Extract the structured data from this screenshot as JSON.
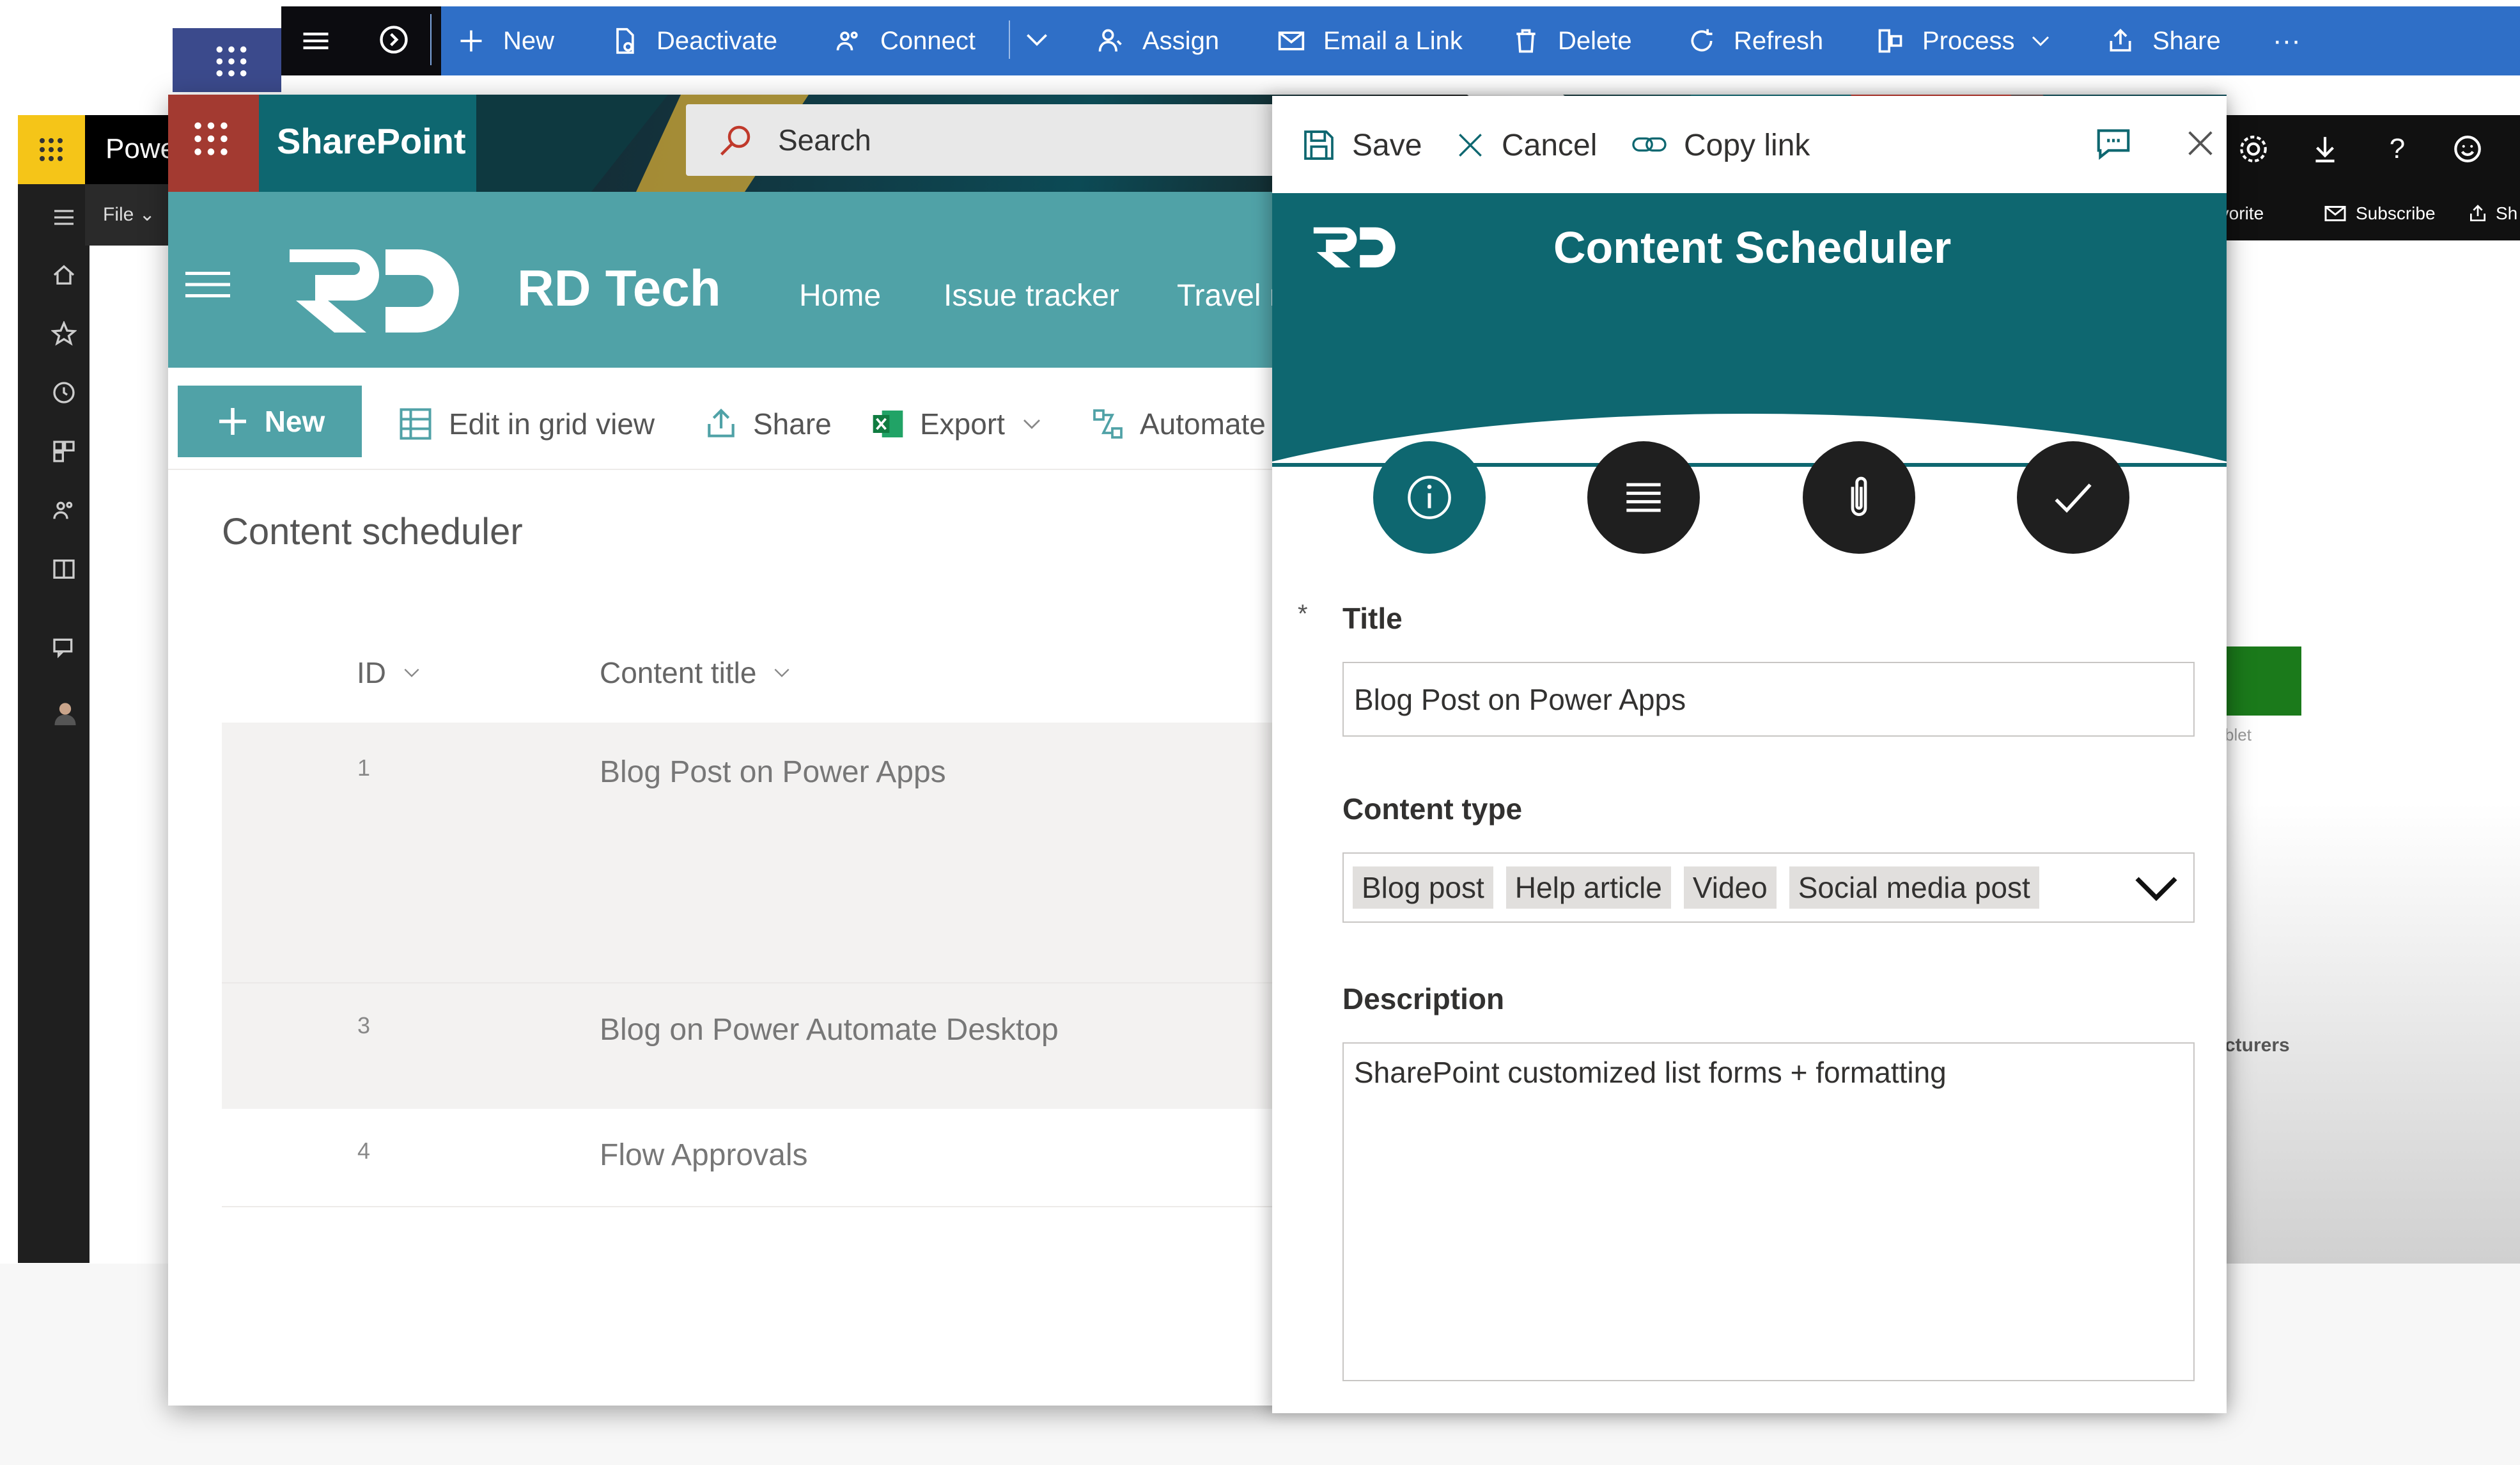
{
  "command_bar": {
    "items": [
      {
        "label": "New",
        "icon": "plus-icon"
      },
      {
        "label": "Deactivate",
        "icon": "document-icon"
      },
      {
        "label": "Connect",
        "icon": "people-icon"
      },
      {
        "label": "Assign",
        "icon": "person-icon"
      },
      {
        "label": "Email a Link",
        "icon": "email-icon"
      },
      {
        "label": "Delete",
        "icon": "trash-icon"
      },
      {
        "label": "Refresh",
        "icon": "refresh-icon"
      },
      {
        "label": "Process",
        "icon": "process-icon"
      },
      {
        "label": "Share",
        "icon": "share-icon"
      }
    ],
    "overflow": "···"
  },
  "background_app": {
    "title_fragment": "Powe",
    "file_menu": "File",
    "favorite": "Favorite",
    "subscribe": "Subscribe",
    "share_fragment": "Sh",
    "text_fragment_1": "blet",
    "text_fragment_2": "cturers"
  },
  "sharepoint": {
    "brand": "SharePoint",
    "search_placeholder": "Search",
    "site_title": "RD Tech",
    "nav": [
      "Home",
      "Issue tracker",
      "Travel r"
    ],
    "toolbar": {
      "new": "New",
      "edit_grid": "Edit in grid view",
      "share": "Share",
      "export": "Export",
      "automate": "Automate"
    },
    "list_title": "Content scheduler",
    "columns": {
      "id": "ID",
      "title": "Content title"
    },
    "rows": [
      {
        "id": "1",
        "title": "Blog Post on Power Apps"
      },
      {
        "id": "3",
        "title": "Blog on Power Automate Desktop"
      },
      {
        "id": "4",
        "title": "Flow Approvals"
      }
    ]
  },
  "panel": {
    "save": "Save",
    "cancel": "Cancel",
    "copy_link": "Copy link",
    "app_title": "Content Scheduler",
    "required_marker": "*",
    "title_label": "Title",
    "title_value": "Blog Post on Power Apps",
    "content_type_label": "Content type",
    "content_types": [
      "Blog post",
      "Help article",
      "Video",
      "Social media post"
    ],
    "description_label": "Description",
    "description_value": "SharePoint customized list forms + formatting"
  },
  "colors": {
    "dynamics_blue": "#2f6fc7",
    "teal": "#0e6770",
    "header_teal": "#50a2a7",
    "sharepoint_red": "#a33a31",
    "dark_circle": "#1f1f1f",
    "green_block": "#1b7a1b"
  }
}
